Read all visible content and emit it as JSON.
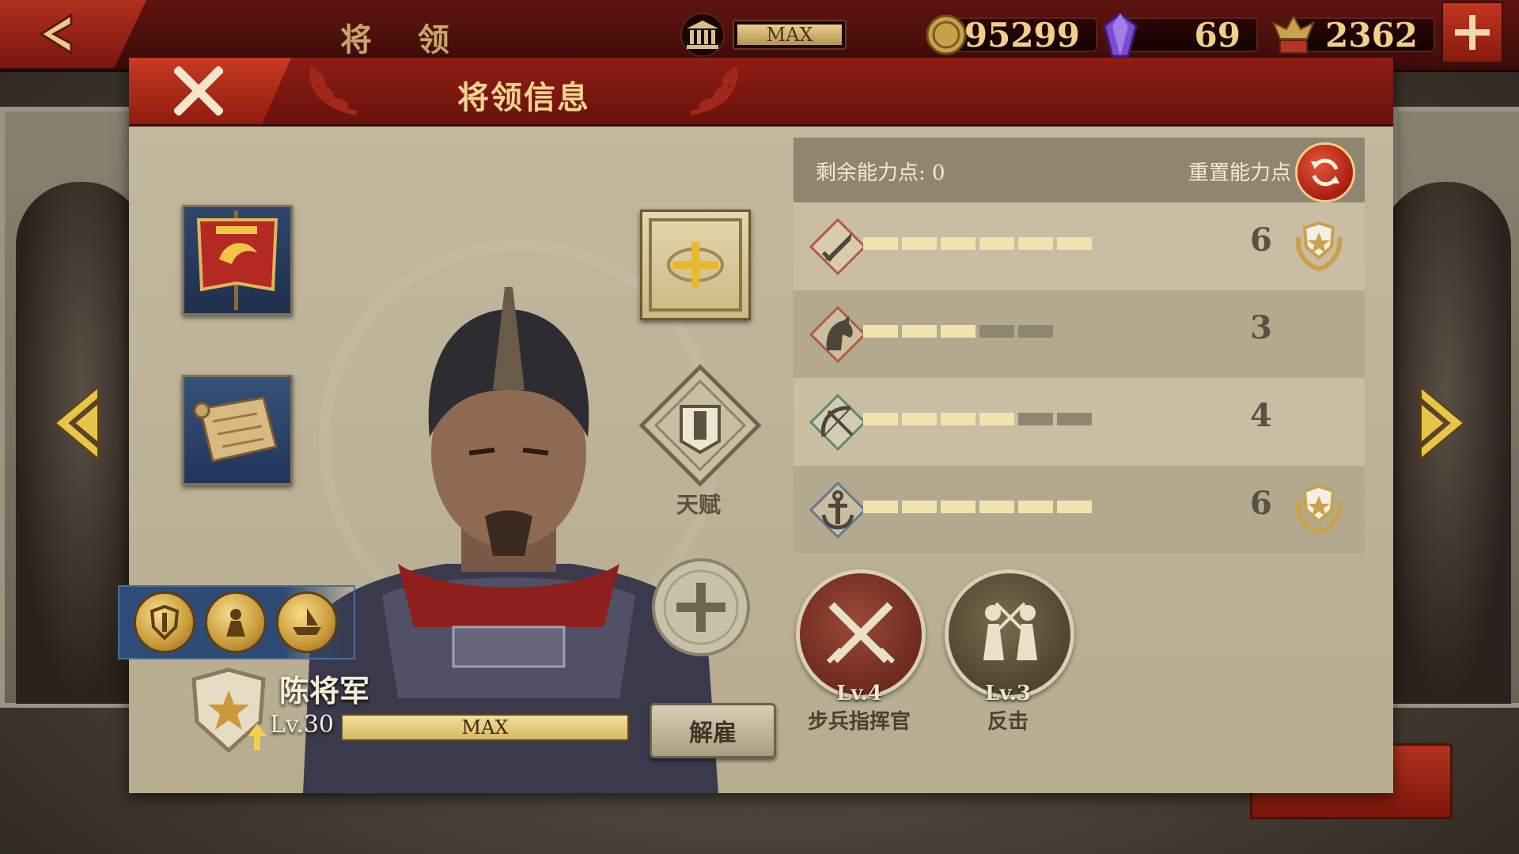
{
  "topbar": {
    "title": "将 领",
    "bank_label": "MAX",
    "coins": "95299",
    "gems": "69",
    "spqr": "2362"
  },
  "panel": {
    "title": "将领信息",
    "talent_label": "天赋"
  },
  "hero": {
    "name": "陈将军",
    "level": "Lv.30",
    "exp_label": "MAX",
    "dismiss_label": "解雇"
  },
  "abilities": {
    "remaining_label": "剩余能力点: 0",
    "reset_label": "重置能力点",
    "rows": [
      {
        "icon": "sword-icon",
        "value": 6,
        "filled": 6,
        "total": 6,
        "maxed": true
      },
      {
        "icon": "horse-icon",
        "value": 3,
        "filled": 3,
        "total": 5,
        "maxed": false
      },
      {
        "icon": "bow-icon",
        "value": 4,
        "filled": 4,
        "total": 6,
        "maxed": false
      },
      {
        "icon": "anchor-icon",
        "value": 6,
        "filled": 6,
        "total": 6,
        "maxed": true
      }
    ]
  },
  "skills": [
    {
      "level": "Lv.4",
      "name": "步兵指挥官",
      "icon": "crossed-swords-icon",
      "color": "#7f3527"
    },
    {
      "level": "Lv.3",
      "name": "反击",
      "icon": "duel-icon",
      "color": "#5a4a34"
    }
  ],
  "colors": {
    "bar_fill": "#f2e3ae",
    "bar_empty": "#8e8572",
    "row_dark": "#b3a98f",
    "row_light": "#c9bea3"
  }
}
